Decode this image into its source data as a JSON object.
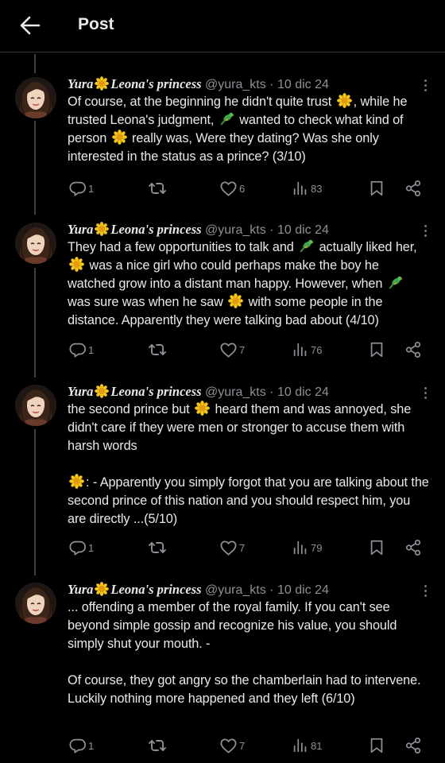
{
  "header": {
    "title": "Post"
  },
  "author": {
    "display_name": "Yura",
    "display_suffix": "Leona's princess",
    "handle": "@yura_kts",
    "date_sep": " · ",
    "date": "10 dic 24"
  },
  "colors": {
    "background": "#000000",
    "text": "#e7e9ea",
    "muted": "#8b9096",
    "divider": "#2f3336",
    "flower": "#f5c518"
  },
  "tweets": [
    {
      "text_parts": [
        "Of course, at the beginning he didn't quite trust ",
        ", while he trusted Leona's judgment, ",
        " wanted to check what kind of person ",
        " really was, Were they dating? Was she only interested in the status as a prince? (3/10)"
      ],
      "replies": "1",
      "likes": "6",
      "views": "83"
    },
    {
      "text_parts": [
        "They had a few opportunities to talk and ",
        " actually liked her, ",
        " was a nice girl who could perhaps make the boy he watched grow into a distant man happy. However, when ",
        " was sure was when he saw ",
        " with some people in the distance. Apparently they were talking bad about (4/10)"
      ],
      "replies": "1",
      "likes": "7",
      "views": "76"
    },
    {
      "text_parts": [
        "the second prince but ",
        " heard them and was annoyed, she didn't care if they were men or stronger to accuse them with harsh words",
        ": - Apparently you simply forgot that you are talking about the second prince of this nation and you should respect him, you are directly ...(5/10)"
      ],
      "replies": "1",
      "likes": "7",
      "views": "79"
    },
    {
      "text_parts": [
        "... offending a member of the royal family. If you can't see beyond simple gossip and recognize his value, you should simply shut your mouth. -",
        "Of course, they got angry so the chamberlain had to intervene. Luckily nothing more happened and they left (6/10)"
      ],
      "replies": "1",
      "likes": "7",
      "views": "81"
    }
  ],
  "icons": {
    "back": "arrow-left-icon",
    "more": "more-vertical-icon",
    "reply": "reply-icon",
    "retweet": "retweet-icon",
    "like": "heart-icon",
    "views": "views-icon",
    "bookmark": "bookmark-icon",
    "share": "share-icon",
    "flower": "sunflower-emoji",
    "bird": "parrot-emoji"
  }
}
